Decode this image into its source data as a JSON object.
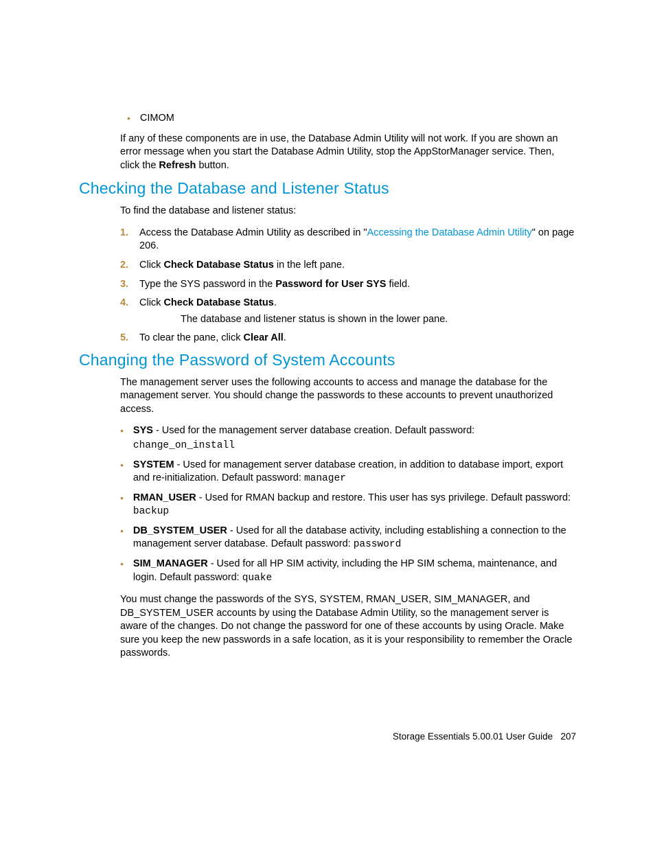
{
  "intro": {
    "bullet1": "CIMOM",
    "para1_a": "If any of these components are in use, the Database Admin Utility will not work. If you are shown an error message when you start the Database Admin Utility, stop the AppStorManager service. Then, click the ",
    "para1_b": "Refresh",
    "para1_c": " button."
  },
  "sec1": {
    "title": "Checking the Database and Listener Status",
    "lead": "To find the database and listener status:",
    "steps": {
      "n1": "1.",
      "s1a": "Access the Database Admin Utility as described in \"",
      "s1link": "Accessing the Database Admin Utility",
      "s1b": "\" on page 206.",
      "n2": "2.",
      "s2a": "Click ",
      "s2b": "Check Database Status",
      "s2c": " in the left pane.",
      "n3": "3.",
      "s3a": "Type the SYS password in the ",
      "s3b": "Password for User SYS",
      "s3c": " field.",
      "n4": "4.",
      "s4a": "Click ",
      "s4b": "Check Database Status",
      "s4c": ".",
      "s4sub": "The database and listener status is shown in the lower pane.",
      "n5": "5.",
      "s5a": "To clear the pane, click ",
      "s5b": "Clear All",
      "s5c": "."
    }
  },
  "sec2": {
    "title": "Changing the Password of System Accounts",
    "lead": "The management server uses the following accounts to access and manage the database for the management server. You should change the passwords to these accounts to prevent unauthorized access.",
    "items": {
      "i1b": "SYS",
      "i1t": " - Used for the management server database creation. Default password: ",
      "i1m": "change_on_install",
      "i2b": "SYSTEM",
      "i2t": " - Used for management server database creation, in addition to database import, export and re-initialization. Default password: ",
      "i2m": "manager",
      "i3b": "RMAN_USER",
      "i3t": " - Used for RMAN backup and restore. This user has sys privilege. Default password: ",
      "i3m": "backup",
      "i4b": "DB_SYSTEM_USER",
      "i4t": " - Used for all the database activity, including establishing a connection to the management server database. Default password: ",
      "i4m": "password",
      "i5b": "SIM_MANAGER",
      "i5t": " - Used for all HP SIM activity, including the HP SIM schema, maintenance, and login. Default password: ",
      "i5m": "quake"
    },
    "trail": "You must change the passwords of the SYS, SYSTEM, RMAN_USER, SIM_MANAGER, and DB_SYSTEM_USER accounts by using the Database Admin Utility, so the management server is aware of the changes. Do not change the password for one of these accounts by using Oracle. Make sure you keep the new passwords in a safe location, as it is your responsibility to remember the Oracle passwords."
  },
  "footer": {
    "text": "Storage Essentials 5.00.01 User Guide",
    "page": "207"
  }
}
